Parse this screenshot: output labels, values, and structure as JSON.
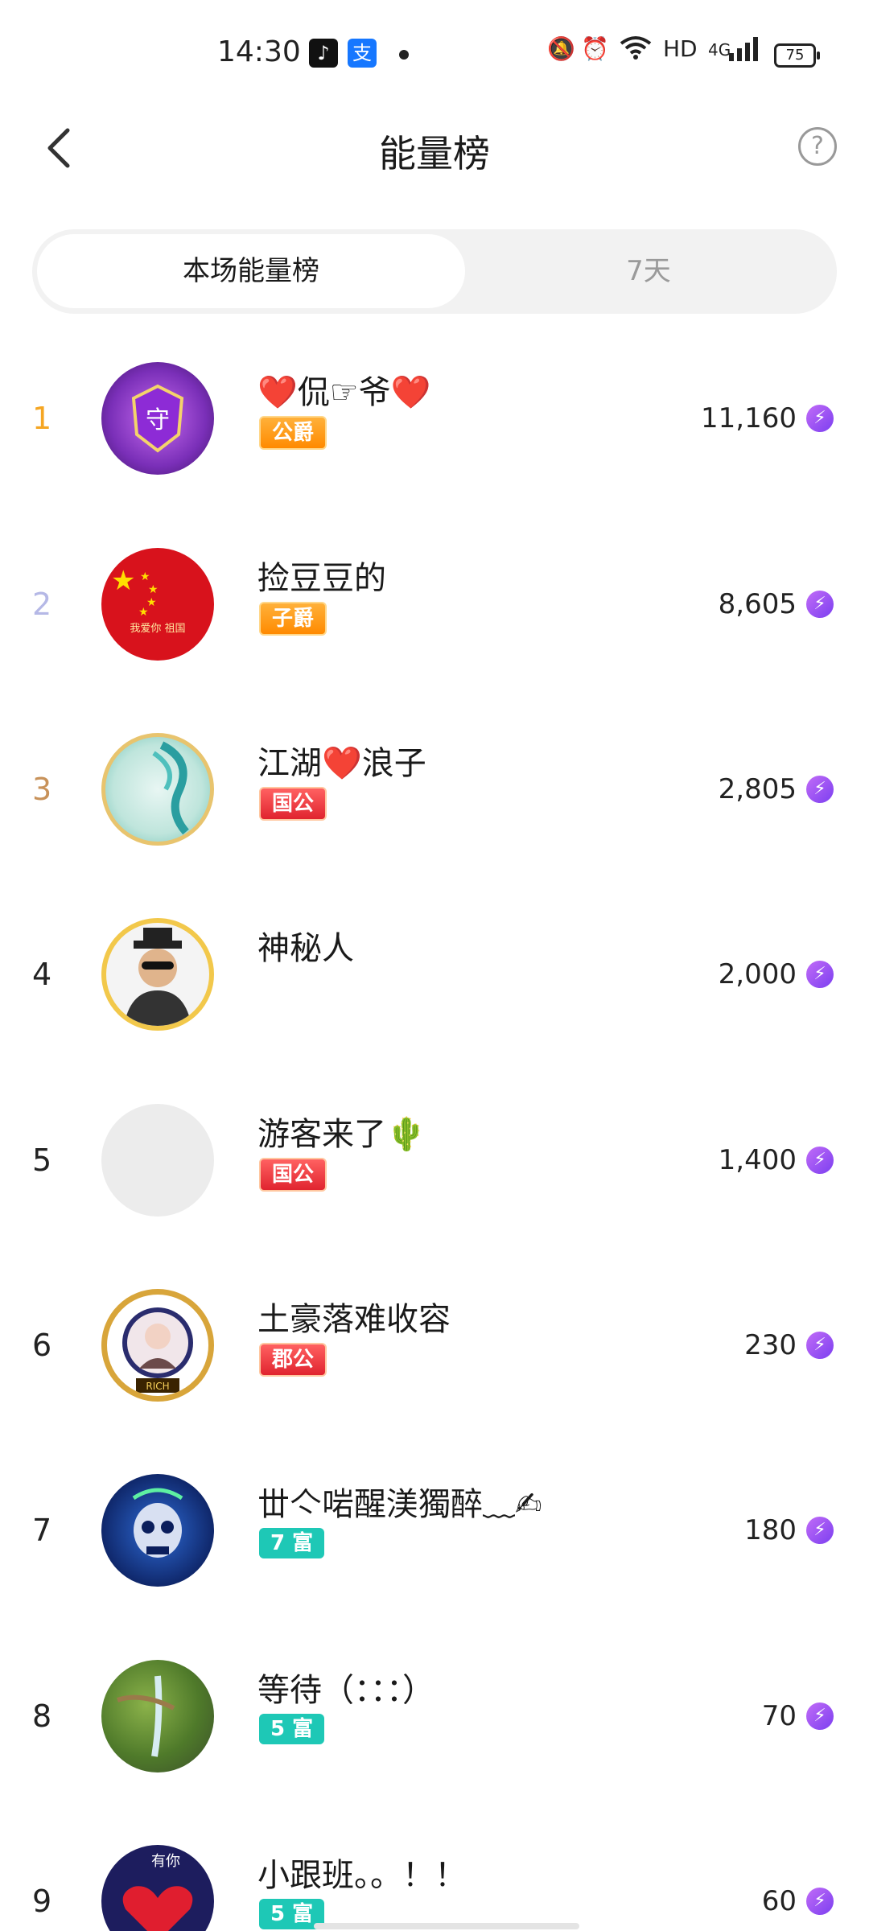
{
  "status_bar": {
    "time": "14:30",
    "app_icons": [
      "tiktok-icon",
      "alipay-icon"
    ],
    "network": "HD",
    "signal": "4G",
    "battery": "75"
  },
  "header": {
    "title": "能量榜",
    "back_icon": "chevron-left-icon",
    "help_icon": "question-circle-icon"
  },
  "tabs": [
    {
      "label": "本场能量榜",
      "active": true
    },
    {
      "label": "7天",
      "active": false
    }
  ],
  "rank_colors": {
    "1": "#f5a623",
    "2": "#b5b8e6",
    "3": "#c8925a",
    "default": "#222222"
  },
  "list": [
    {
      "rank": "1",
      "name": "❤️侃☞爷❤️",
      "badge": "公爵",
      "badge_style": "orange",
      "score": "11,160"
    },
    {
      "rank": "2",
      "name": "捡豆豆的",
      "badge": "子爵",
      "badge_style": "orange",
      "score": "8,605"
    },
    {
      "rank": "3",
      "name": "江湖❤️浪子",
      "badge": "国公",
      "badge_style": "red",
      "score": "2,805"
    },
    {
      "rank": "4",
      "name": "神秘人",
      "badge": "",
      "badge_style": "",
      "score": "2,000"
    },
    {
      "rank": "5",
      "name": "游客来了🌵",
      "badge": "国公",
      "badge_style": "red",
      "score": "1,400"
    },
    {
      "rank": "6",
      "name": "土豪落难收容",
      "badge": "郡公",
      "badge_style": "red",
      "score": "230"
    },
    {
      "rank": "7",
      "name": "丗亽啱醒渼獨醉﹏✍",
      "badge": "7 富",
      "badge_style": "teal",
      "score": "180"
    },
    {
      "rank": "8",
      "name": "等待（：：：）",
      "badge": "5 富",
      "badge_style": "teal",
      "score": "70"
    },
    {
      "rank": "9",
      "name": "小跟班。。！！",
      "badge": "5 富",
      "badge_style": "teal",
      "score": "60"
    }
  ],
  "energy_icon": "lightning-icon"
}
